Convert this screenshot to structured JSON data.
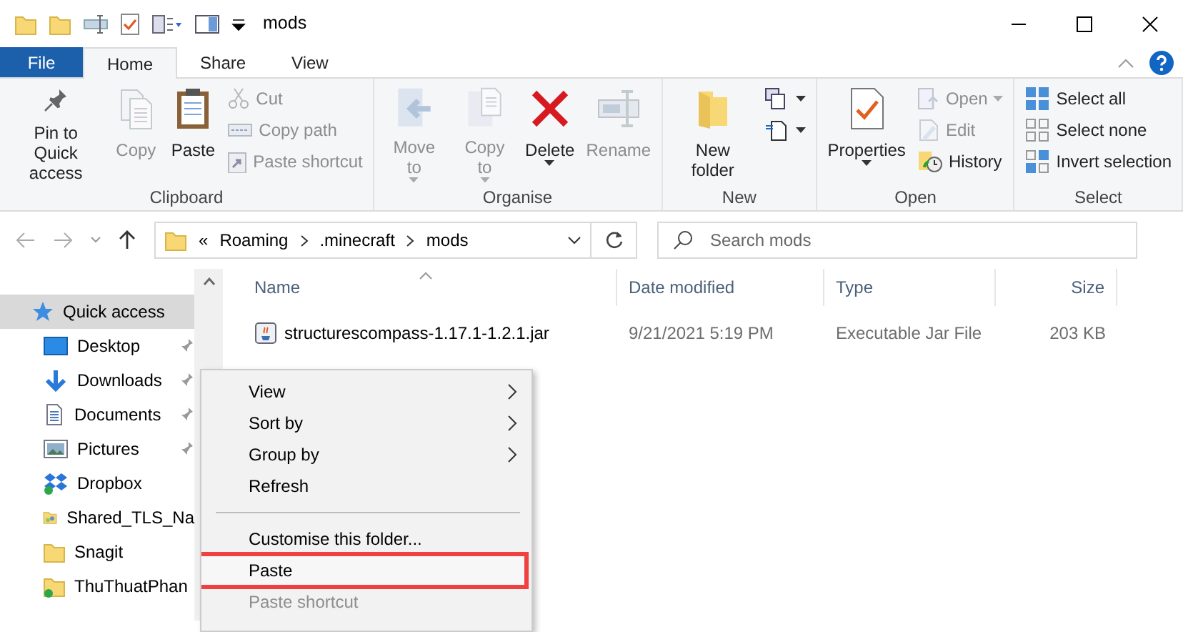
{
  "window": {
    "title": "mods"
  },
  "tabs": [
    {
      "label": "File",
      "kind": "file",
      "selected": false
    },
    {
      "label": "Home",
      "kind": "tab",
      "selected": true
    },
    {
      "label": "Share",
      "kind": "tab",
      "selected": false
    },
    {
      "label": "View",
      "kind": "tab",
      "selected": false
    }
  ],
  "ribbon": {
    "groups": [
      {
        "label": "Clipboard",
        "items": [
          {
            "kind": "large",
            "label": "Pin to Quick access",
            "disabled": false,
            "dropdown": false
          },
          {
            "kind": "large",
            "label": "Copy",
            "disabled": true,
            "dropdown": false
          },
          {
            "kind": "large",
            "label": "Paste",
            "disabled": false,
            "dropdown": false
          },
          {
            "kind": "small",
            "label": "Cut",
            "disabled": true,
            "dropdown": false
          },
          {
            "kind": "small",
            "label": "Copy path",
            "disabled": true,
            "dropdown": false
          },
          {
            "kind": "small",
            "label": "Paste shortcut",
            "disabled": true,
            "dropdown": false
          }
        ]
      },
      {
        "label": "Organise",
        "items": [
          {
            "kind": "large",
            "label": "Move to",
            "disabled": true,
            "dropdown": true
          },
          {
            "kind": "large",
            "label": "Copy to",
            "disabled": true,
            "dropdown": true
          },
          {
            "kind": "large",
            "label": "Delete",
            "disabled": false,
            "dropdown": true
          },
          {
            "kind": "large",
            "label": "Rename",
            "disabled": true,
            "dropdown": false
          }
        ]
      },
      {
        "label": "New",
        "items": [
          {
            "kind": "large",
            "label": "New folder",
            "disabled": false,
            "dropdown": false
          },
          {
            "kind": "icon",
            "disabled": false,
            "dropdown": true
          },
          {
            "kind": "icon",
            "disabled": false,
            "dropdown": true
          }
        ]
      },
      {
        "label": "Open",
        "items": [
          {
            "kind": "large",
            "label": "Properties",
            "disabled": false,
            "dropdown": true
          },
          {
            "kind": "small",
            "label": "Open",
            "disabled": true,
            "dropdown": true
          },
          {
            "kind": "small",
            "label": "Edit",
            "disabled": true,
            "dropdown": false
          },
          {
            "kind": "small",
            "label": "History",
            "disabled": false,
            "dropdown": false
          }
        ]
      },
      {
        "label": "Select",
        "items": [
          {
            "kind": "small",
            "label": "Select all",
            "disabled": false,
            "dropdown": false
          },
          {
            "kind": "small",
            "label": "Select none",
            "disabled": false,
            "dropdown": false
          },
          {
            "kind": "small",
            "label": "Invert selection",
            "disabled": false,
            "dropdown": false
          }
        ]
      }
    ]
  },
  "address_bar": {
    "overflow": "«",
    "crumbs": [
      "Roaming",
      ".minecraft",
      "mods"
    ]
  },
  "search": {
    "placeholder": "Search mods"
  },
  "sidebar": {
    "items": [
      {
        "label": "Quick access",
        "selected": true,
        "pinned": false
      },
      {
        "label": "Desktop",
        "selected": false,
        "pinned": true
      },
      {
        "label": "Downloads",
        "selected": false,
        "pinned": true
      },
      {
        "label": "Documents",
        "selected": false,
        "pinned": true
      },
      {
        "label": "Pictures",
        "selected": false,
        "pinned": true
      },
      {
        "label": "Dropbox",
        "selected": false,
        "pinned": false
      },
      {
        "label": "Shared_TLS_Na",
        "selected": false,
        "pinned": false
      },
      {
        "label": "Snagit",
        "selected": false,
        "pinned": false
      },
      {
        "label": "ThuThuatPhan",
        "selected": false,
        "pinned": false
      }
    ]
  },
  "file_list": {
    "columns": [
      "Name",
      "Date modified",
      "Type",
      "Size"
    ],
    "rows": [
      {
        "cells": [
          "structurescompass-1.17.1-1.2.1.jar",
          "9/21/2021 5:19 PM",
          "Executable Jar File",
          "203 KB"
        ],
        "selected": false
      }
    ]
  },
  "context_menu": {
    "items": [
      {
        "kind": "item",
        "label": "View",
        "submenu": true,
        "disabled": false,
        "highlighted": false
      },
      {
        "kind": "item",
        "label": "Sort by",
        "submenu": true,
        "disabled": false,
        "highlighted": false
      },
      {
        "kind": "item",
        "label": "Group by",
        "submenu": true,
        "disabled": false,
        "highlighted": false
      },
      {
        "kind": "item",
        "label": "Refresh",
        "submenu": false,
        "disabled": false,
        "highlighted": false
      },
      {
        "kind": "separator"
      },
      {
        "kind": "item",
        "label": "Customise this folder...",
        "submenu": false,
        "disabled": false,
        "highlighted": false
      },
      {
        "kind": "item",
        "label": "Paste",
        "submenu": false,
        "disabled": false,
        "highlighted": true
      },
      {
        "kind": "item",
        "label": "Paste shortcut",
        "submenu": false,
        "disabled": true,
        "highlighted": false
      }
    ]
  }
}
